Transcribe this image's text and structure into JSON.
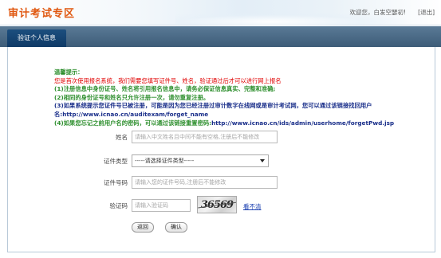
{
  "header": {
    "title": "审计考试专区",
    "welcome": "欢迎您，白发空瑟初!",
    "logout": "[退出]"
  },
  "nav": {
    "tab_label": "验证个人信息"
  },
  "tips": {
    "title": "温馨提示：",
    "line1": "您是首次使用报名系统，我们需要您填写证件号、姓名，验证通过后才可以进行网上报名",
    "line2": "(1)注册信息中身份证号、姓名将引用报名信息中，请务必保证信息真实、完整和准确;",
    "line3": "(2)相同的身份证号和姓名只允许注册一次，请勿重复注册。",
    "line4": "(3)如果系统提示您证件号已被注册，可能是因为您已经注册过审计数字在线网或是审计考试网，您可以通过该链接找回用户",
    "line5_prefix": "名:",
    "line5_url": "http://www.icnao.cn/auditexam/forget_name",
    "line6_prefix": "(4)如果您忘记之前用户名的密码，可以通过该链接重置密码:",
    "line6_url": "http://www.icnao.cn/ids/admin/userhome/forgetPwd.jsp"
  },
  "form": {
    "name_label": "姓名",
    "name_placeholder": "请输入中文姓名且中间不能有空格,注册后不能修改",
    "cert_type_label": "证件类型",
    "cert_type_selected": "-----请选择证件类型-----",
    "cert_no_label": "证件号码",
    "cert_no_placeholder": "请输入您的证件号码,注册后不能修改",
    "captcha_label": "验证码",
    "captcha_placeholder": "请输入验证码",
    "captcha_text": "36569",
    "refresh_link": "看不清"
  },
  "buttons": {
    "back": "返回",
    "confirm": "确认"
  },
  "colors": {
    "title": "#e0570f",
    "nav_bar": "#4a6a87",
    "nav_tab": "#1c4e7e",
    "tip_title": "#2e8f2e",
    "tip_red": "#e00000",
    "tip_blue": "#1a2f8a"
  }
}
